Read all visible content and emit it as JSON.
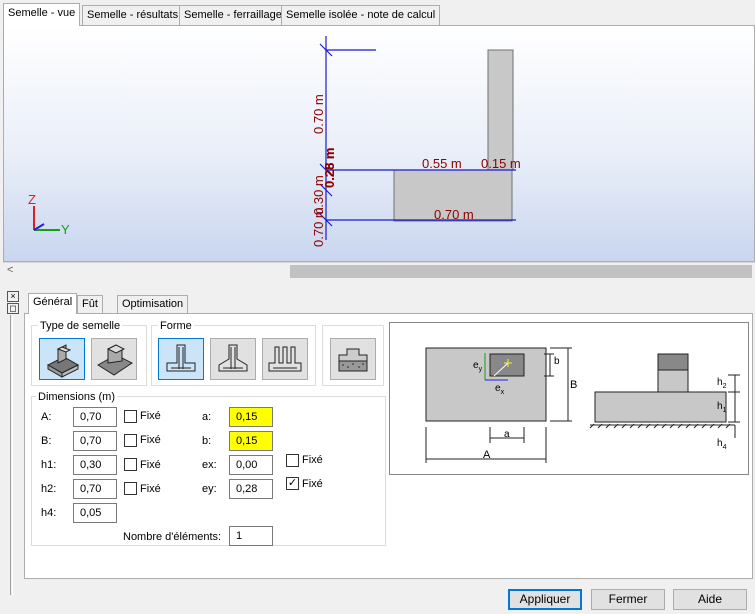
{
  "top_tabs": [
    "Semelle - vue",
    "Semelle - résultats",
    "Semelle - ferraillage",
    "Semelle isolée - note de calcul"
  ],
  "view": {
    "dims": {
      "d070_vertical": "0.70 m",
      "d055": "0.55 m",
      "d015": "0.15 m",
      "d070_horizontal": "0.70 m",
      "d028": "0.28 m",
      "d025": "0.25 m",
      "d030": "0.30 m",
      "d070_left": "0.70 m"
    },
    "axes": {
      "z": "Z",
      "y": "Y"
    },
    "colors": {
      "footing": "#c8c8c8",
      "dim": "#8b0000",
      "axis_z": "#e02020",
      "axis_y": "#10a010",
      "axis_x": "#2020e0"
    }
  },
  "side_buttons": [
    "×",
    "◻"
  ],
  "sub_tabs": [
    "Général",
    "Fût",
    "Optimisation"
  ],
  "type_group": {
    "label": "Type de semelle",
    "icons": [
      "isolated-footing-icon",
      "strip-footing-icon"
    ]
  },
  "forme_group": {
    "label": "Forme",
    "icons": [
      "footing-shape-1-icon",
      "footing-shape-2-icon",
      "footing-shape-3-icon"
    ]
  },
  "soil_icon": "soil-icon",
  "dimensions": {
    "label": "Dimensions (m)",
    "left_fields": [
      {
        "label": "A:",
        "value": "0,70",
        "fixed_label": "Fixé",
        "checked": false
      },
      {
        "label": "B:",
        "value": "0,70",
        "fixed_label": "Fixé",
        "checked": false
      },
      {
        "label": "h1:",
        "value": "0,30",
        "fixed_label": "Fixé",
        "checked": false
      },
      {
        "label": "h2:",
        "value": "0,70",
        "fixed_label": "Fixé",
        "checked": false
      },
      {
        "label": "h4:",
        "value": "0,05"
      }
    ],
    "right_fields": [
      {
        "label": "a:",
        "value": "0,15"
      },
      {
        "label": "b:",
        "value": "0,15"
      },
      {
        "label": "ex:",
        "value": "0,00",
        "fixed_label": "Fixé",
        "checked": false
      },
      {
        "label": "ey:",
        "value": "0,28",
        "fixed_label": "Fixé",
        "checked": true
      }
    ],
    "nb_label": "Nombre d'éléments:",
    "nb_value": "1"
  },
  "schema": {
    "ey": "e",
    "ey_sub": "y",
    "ex": "e",
    "ex_sub": "x",
    "b": "b",
    "B": "B",
    "a": "a",
    "A": "A",
    "h2": "h",
    "h2_sub": "2",
    "h1": "h",
    "h1_sub": "1",
    "h4": "h",
    "h4_sub": "4"
  },
  "buttons": {
    "apply": "Appliquer",
    "close": "Fermer",
    "help": "Aide"
  }
}
